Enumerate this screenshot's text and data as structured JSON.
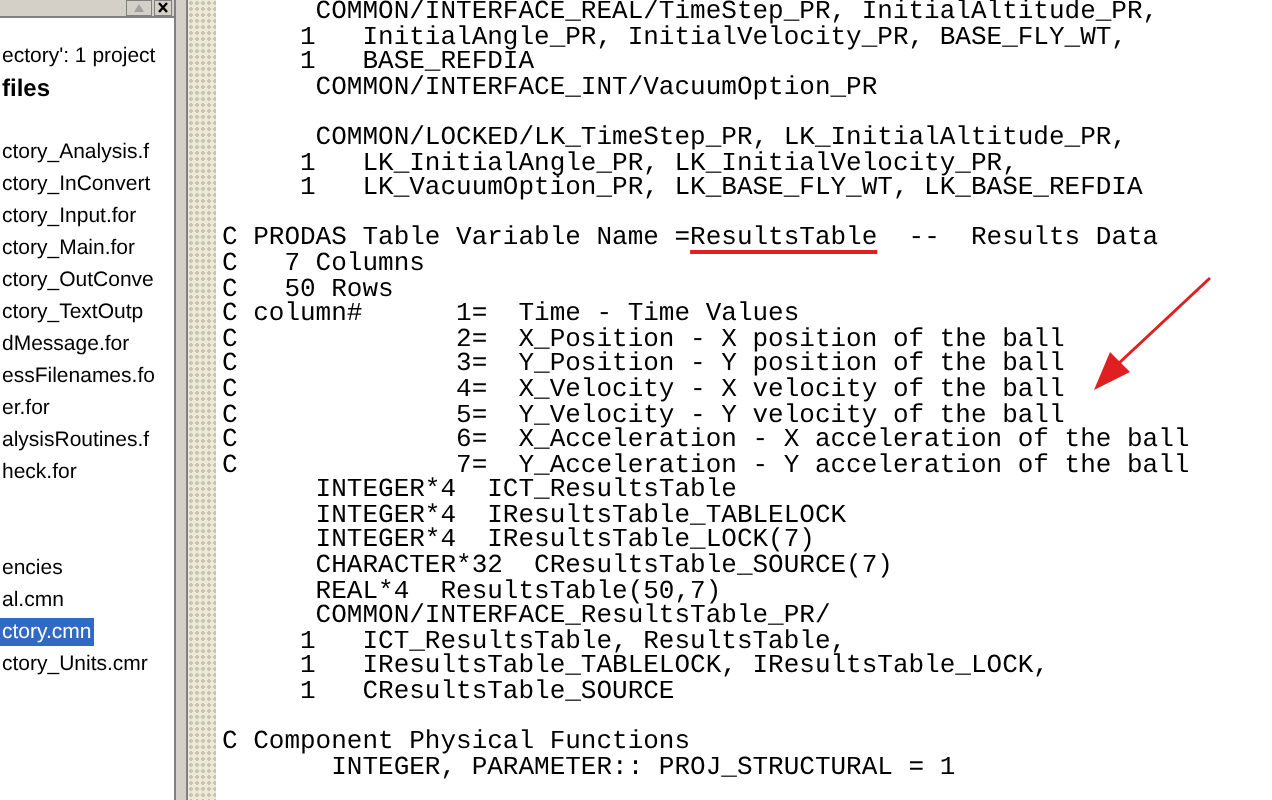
{
  "project_tree": {
    "items": [
      {
        "label": "ectory': 1 project",
        "kind": "plain",
        "selected": false
      },
      {
        "label": "files",
        "kind": "bold",
        "selected": false
      },
      {
        "kind": "gap"
      },
      {
        "label": "ctory_Analysis.f",
        "kind": "plain",
        "selected": false
      },
      {
        "label": "ctory_InConvert",
        "kind": "plain",
        "selected": false
      },
      {
        "label": "ctory_Input.for",
        "kind": "plain",
        "selected": false
      },
      {
        "label": "ctory_Main.for",
        "kind": "plain",
        "selected": false
      },
      {
        "label": "ctory_OutConve",
        "kind": "plain",
        "selected": false
      },
      {
        "label": "ctory_TextOutp",
        "kind": "plain",
        "selected": false
      },
      {
        "label": "dMessage.for",
        "kind": "plain",
        "selected": false
      },
      {
        "label": "essFilenames.fo",
        "kind": "plain",
        "selected": false
      },
      {
        "label": "er.for",
        "kind": "plain",
        "selected": false
      },
      {
        "label": "alysisRoutines.f",
        "kind": "plain",
        "selected": false
      },
      {
        "label": "heck.for",
        "kind": "plain",
        "selected": false
      },
      {
        "kind": "gap"
      },
      {
        "kind": "gap"
      },
      {
        "label": "encies",
        "kind": "plain",
        "selected": false
      },
      {
        "label": "al.cmn",
        "kind": "plain",
        "selected": false
      },
      {
        "label": "ctory.cmn",
        "kind": "plain",
        "selected": true
      },
      {
        "label": "ctory_Units.cmr",
        "kind": "plain",
        "selected": false
      }
    ]
  },
  "editor": {
    "lines": [
      {
        "kind": "code",
        "text": "      COMMON/INTERFACE_REAL/TimeStep_PR, InitialAltitude_PR,"
      },
      {
        "kind": "code",
        "text": "     1   InitialAngle_PR, InitialVelocity_PR, BASE_FLY_WT,"
      },
      {
        "kind": "code",
        "text": "     1   BASE_REFDIA"
      },
      {
        "kind": "code",
        "text": "      COMMON/INTERFACE_INT/VacuumOption_PR"
      },
      {
        "kind": "blank"
      },
      {
        "kind": "code",
        "text": "      COMMON/LOCKED/LK_TimeStep_PR, LK_InitialAltitude_PR,"
      },
      {
        "kind": "code",
        "text": "     1   LK_InitialAngle_PR, LK_InitialVelocity_PR,"
      },
      {
        "kind": "code",
        "text": "     1   LK_VacuumOption_PR, LK_BASE_FLY_WT, LK_BASE_REFDIA"
      },
      {
        "kind": "blank"
      },
      {
        "kind": "annotated",
        "parts": [
          {
            "text": "C PRODAS Table Variable Name =",
            "underlined": false
          },
          {
            "text": "ResultsTable",
            "underlined": true
          },
          {
            "text": "  --  Results Data",
            "underlined": false
          }
        ]
      },
      {
        "kind": "code",
        "text": "C   7 Columns"
      },
      {
        "kind": "code",
        "text": "C   50 Rows"
      },
      {
        "kind": "code",
        "text": "C column#      1=  Time - Time Values"
      },
      {
        "kind": "code",
        "text": "C              2=  X_Position - X position of the ball"
      },
      {
        "kind": "code",
        "text": "C              3=  Y_Position - Y position of the ball"
      },
      {
        "kind": "code",
        "text": "C              4=  X_Velocity - X velocity of the ball"
      },
      {
        "kind": "code",
        "text": "C              5=  Y_Velocity - Y velocity of the ball"
      },
      {
        "kind": "code",
        "text": "C              6=  X_Acceleration - X acceleration of the ball"
      },
      {
        "kind": "code",
        "text": "C              7=  Y_Acceleration - Y acceleration of the ball"
      },
      {
        "kind": "code",
        "text": "      INTEGER*4  ICT_ResultsTable"
      },
      {
        "kind": "code",
        "text": "      INTEGER*4  IResultsTable_TABLELOCK"
      },
      {
        "kind": "code",
        "text": "      INTEGER*4  IResultsTable_LOCK(7)"
      },
      {
        "kind": "code",
        "text": "      CHARACTER*32  CResultsTable_SOURCE(7)"
      },
      {
        "kind": "code",
        "text": "      REAL*4  ResultsTable(50,7)"
      },
      {
        "kind": "code",
        "text": "      COMMON/INTERFACE_ResultsTable_PR/"
      },
      {
        "kind": "code",
        "text": "     1   ICT_ResultsTable, ResultsTable,"
      },
      {
        "kind": "code",
        "text": "     1   IResultsTable_TABLELOCK, IResultsTable_LOCK,"
      },
      {
        "kind": "code",
        "text": "     1   CResultsTable_SOURCE"
      },
      {
        "kind": "blank"
      },
      {
        "kind": "code",
        "text": "C Component Physical Functions"
      },
      {
        "kind": "code",
        "text": "       INTEGER, PARAMETER:: PROJ_STRUCTURAL = 1"
      }
    ],
    "annotations": [
      {
        "kind": "arrow"
      }
    ]
  }
}
